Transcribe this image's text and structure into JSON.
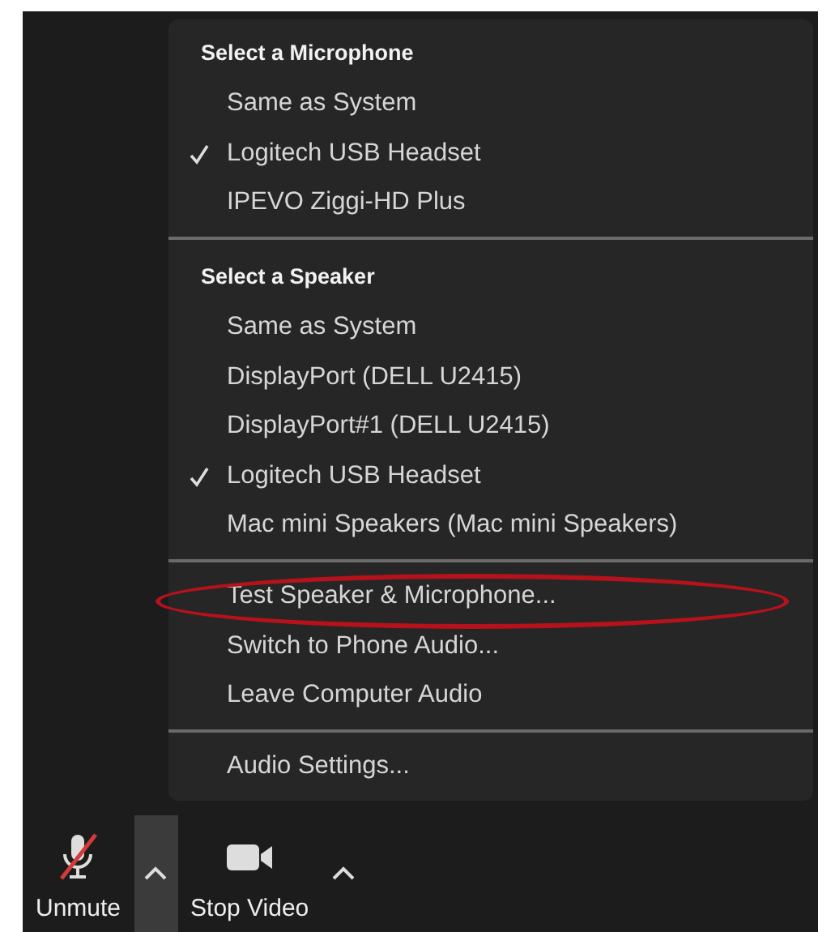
{
  "menu": {
    "sections": [
      {
        "kind": "choice",
        "title": "Select a Microphone",
        "items": [
          {
            "label": "Same as System",
            "checked": false
          },
          {
            "label": "Logitech USB Headset",
            "checked": true
          },
          {
            "label": "IPEVO Ziggi-HD Plus",
            "checked": false
          }
        ]
      },
      {
        "kind": "choice",
        "title": "Select a Speaker",
        "items": [
          {
            "label": "Same as System",
            "checked": false
          },
          {
            "label": "DisplayPort (DELL U2415)",
            "checked": false
          },
          {
            "label": "DisplayPort#1 (DELL U2415)",
            "checked": false
          },
          {
            "label": "Logitech USB Headset",
            "checked": true
          },
          {
            "label": "Mac mini Speakers (Mac mini Speakers)",
            "checked": false
          }
        ]
      },
      {
        "kind": "action",
        "items": [
          {
            "label": "Test Speaker & Microphone...",
            "highlighted": true
          },
          {
            "label": "Switch to Phone Audio...",
            "highlighted": false
          },
          {
            "label": "Leave Computer Audio",
            "highlighted": false
          }
        ]
      },
      {
        "kind": "action",
        "items": [
          {
            "label": "Audio Settings...",
            "highlighted": false
          }
        ]
      }
    ]
  },
  "toolbar": {
    "buttons": [
      {
        "kind": "mic",
        "label": "Unmute",
        "muted": true,
        "menu_open": true
      },
      {
        "kind": "video",
        "label": "Stop Video",
        "menu_open": false
      }
    ]
  }
}
